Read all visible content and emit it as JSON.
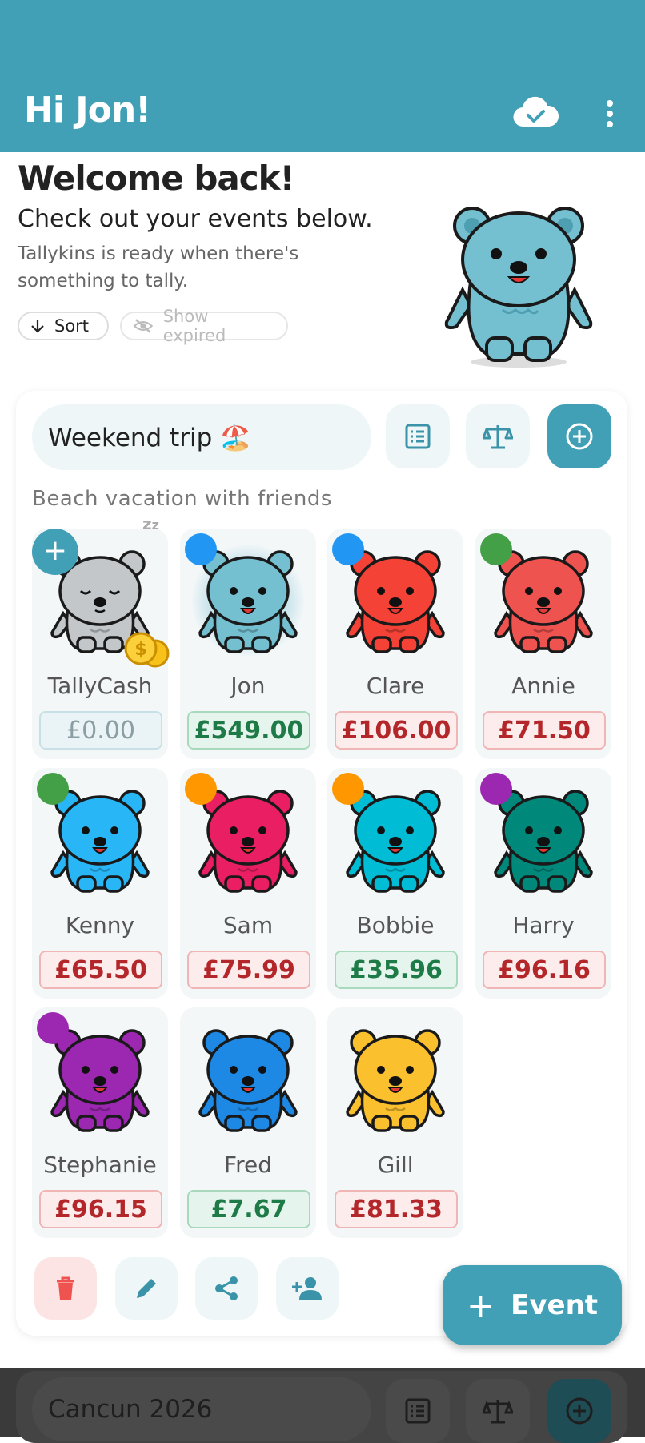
{
  "app_bar": {
    "title": "Hi Jon!",
    "sync_icon": "cloud-check-icon",
    "menu_icon": "more-vert-icon"
  },
  "welcome": {
    "title": "Welcome back!",
    "subtitle": "Check out your events below.",
    "description": "Tallykins is ready when there's something to tally.",
    "sort_label": "Sort",
    "expired_label": "Show expired"
  },
  "event": {
    "name": "Weekend trip 🏖️",
    "description": "Beach vacation with friends",
    "participants": [
      {
        "name": "TallyCash",
        "amount": "£0.00",
        "status": "zero",
        "bear_color": "#c3c7ca",
        "dot_color": "",
        "sleeping": true
      },
      {
        "name": "Jon",
        "amount": "£549.00",
        "status": "pos",
        "bear_color": "#74bfd0",
        "dot_color": "#2196f3",
        "highlight": true
      },
      {
        "name": "Clare",
        "amount": "£106.00",
        "status": "neg",
        "bear_color": "#f44336",
        "dot_color": "#2196f3"
      },
      {
        "name": "Annie",
        "amount": "£71.50",
        "status": "neg",
        "bear_color": "#ef5350",
        "dot_color": "#43a047"
      },
      {
        "name": "Kenny",
        "amount": "£65.50",
        "status": "neg",
        "bear_color": "#29b6f6",
        "dot_color": "#43a047"
      },
      {
        "name": "Sam",
        "amount": "£75.99",
        "status": "neg",
        "bear_color": "#e91e63",
        "dot_color": "#ff9800"
      },
      {
        "name": "Bobbie",
        "amount": "£35.96",
        "status": "pos",
        "bear_color": "#00bcd4",
        "dot_color": "#ff9800"
      },
      {
        "name": "Harry",
        "amount": "£96.16",
        "status": "neg",
        "bear_color": "#00897b",
        "dot_color": "#9c27b0"
      },
      {
        "name": "Stephanie",
        "amount": "£96.15",
        "status": "neg",
        "bear_color": "#9c27b0",
        "dot_color": "#9c27b0"
      },
      {
        "name": "Fred",
        "amount": "£7.67",
        "status": "pos",
        "bear_color": "#1e88e5",
        "dot_color": ""
      },
      {
        "name": "Gill",
        "amount": "£81.33",
        "status": "neg",
        "bear_color": "#fbc02d",
        "dot_color": ""
      }
    ]
  },
  "fab": {
    "label": "Event"
  },
  "next_event": {
    "name": "Cancun 2026"
  },
  "colors": {
    "primary": "#41a0b6",
    "negative": "#b3262a",
    "positive": "#1e7a46"
  }
}
